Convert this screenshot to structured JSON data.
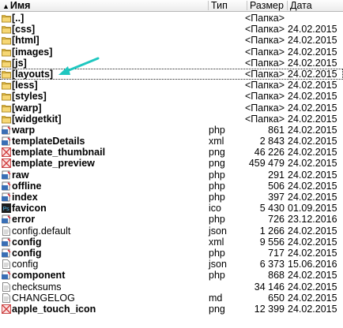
{
  "header": {
    "name_label": "Имя",
    "ext_label": "Тип",
    "size_label": "Размер",
    "date_label": "Дата"
  },
  "rows": [
    {
      "name": "[..]",
      "ext": "",
      "size": "<Папка>",
      "date": "",
      "kind": "dir",
      "icon": "folder-up-icon"
    },
    {
      "name": "[css]",
      "ext": "",
      "size": "<Папка>",
      "date": "24.02.2015",
      "kind": "dir",
      "icon": "folder-icon"
    },
    {
      "name": "[html]",
      "ext": "",
      "size": "<Папка>",
      "date": "24.02.2015",
      "kind": "dir",
      "icon": "folder-icon"
    },
    {
      "name": "[images]",
      "ext": "",
      "size": "<Папка>",
      "date": "24.02.2015",
      "kind": "dir",
      "icon": "folder-icon"
    },
    {
      "name": "[js]",
      "ext": "",
      "size": "<Папка>",
      "date": "24.02.2015",
      "kind": "dir",
      "icon": "folder-icon"
    },
    {
      "name": "[layouts]",
      "ext": "",
      "size": "<Папка>",
      "date": "24.02.2015",
      "kind": "dir",
      "icon": "folder-icon",
      "focused": true
    },
    {
      "name": "[less]",
      "ext": "",
      "size": "<Папка>",
      "date": "24.02.2015",
      "kind": "dir",
      "icon": "folder-icon"
    },
    {
      "name": "[styles]",
      "ext": "",
      "size": "<Папка>",
      "date": "24.02.2015",
      "kind": "dir",
      "icon": "folder-icon"
    },
    {
      "name": "[warp]",
      "ext": "",
      "size": "<Папка>",
      "date": "24.02.2015",
      "kind": "dir",
      "icon": "folder-icon"
    },
    {
      "name": "[widgetkit]",
      "ext": "",
      "size": "<Папка>",
      "date": "24.02.2015",
      "kind": "dir",
      "icon": "folder-icon"
    },
    {
      "name": "warp",
      "ext": "php",
      "size": "861",
      "date": "24.02.2015",
      "kind": "exe",
      "icon": "php-file-icon"
    },
    {
      "name": "templateDetails",
      "ext": "xml",
      "size": "2 843",
      "date": "24.02.2015",
      "kind": "exe",
      "icon": "xml-file-icon"
    },
    {
      "name": "template_thumbnail",
      "ext": "png",
      "size": "46 226",
      "date": "24.02.2015",
      "kind": "exe",
      "icon": "image-file-icon"
    },
    {
      "name": "template_preview",
      "ext": "png",
      "size": "459 479",
      "date": "24.02.2015",
      "kind": "exe",
      "icon": "image-file-icon"
    },
    {
      "name": "raw",
      "ext": "php",
      "size": "291",
      "date": "24.02.2015",
      "kind": "exe",
      "icon": "php-file-icon"
    },
    {
      "name": "offline",
      "ext": "php",
      "size": "506",
      "date": "24.02.2015",
      "kind": "exe",
      "icon": "php-file-icon"
    },
    {
      "name": "index",
      "ext": "php",
      "size": "397",
      "date": "24.02.2015",
      "kind": "exe",
      "icon": "php-file-icon"
    },
    {
      "name": "favicon",
      "ext": "ico",
      "size": "5 430",
      "date": "01.09.2015",
      "kind": "exe",
      "icon": "ico-file-icon"
    },
    {
      "name": "error",
      "ext": "php",
      "size": "726",
      "date": "23.12.2016",
      "kind": "exe",
      "icon": "php-file-icon"
    },
    {
      "name": "config.default",
      "ext": "json",
      "size": "1 266",
      "date": "24.02.2015",
      "kind": "file",
      "icon": "text-file-icon"
    },
    {
      "name": "config",
      "ext": "xml",
      "size": "9 556",
      "date": "24.02.2015",
      "kind": "exe",
      "icon": "xml-file-icon"
    },
    {
      "name": "config",
      "ext": "php",
      "size": "717",
      "date": "24.02.2015",
      "kind": "exe",
      "icon": "php-file-icon"
    },
    {
      "name": "config",
      "ext": "json",
      "size": "6 373",
      "date": "15.06.2016",
      "kind": "file",
      "icon": "text-file-icon"
    },
    {
      "name": "component",
      "ext": "php",
      "size": "868",
      "date": "24.02.2015",
      "kind": "exe",
      "icon": "php-file-icon"
    },
    {
      "name": "checksums",
      "ext": "",
      "size": "34 146",
      "date": "24.02.2015",
      "kind": "file",
      "icon": "text-file-icon"
    },
    {
      "name": "CHANGELOG",
      "ext": "md",
      "size": "650",
      "date": "24.02.2015",
      "kind": "file",
      "icon": "text-file-icon"
    },
    {
      "name": "apple_touch_icon",
      "ext": "png",
      "size": "12 399",
      "date": "24.02.2015",
      "kind": "exe",
      "icon": "image-file-icon"
    }
  ],
  "colors": {
    "folder": "#e8c04a",
    "php": "#3a6fb5",
    "image": "#d23b3b",
    "ico": "#2a2a2a",
    "annotation_arrow": "#1fc7c0"
  }
}
